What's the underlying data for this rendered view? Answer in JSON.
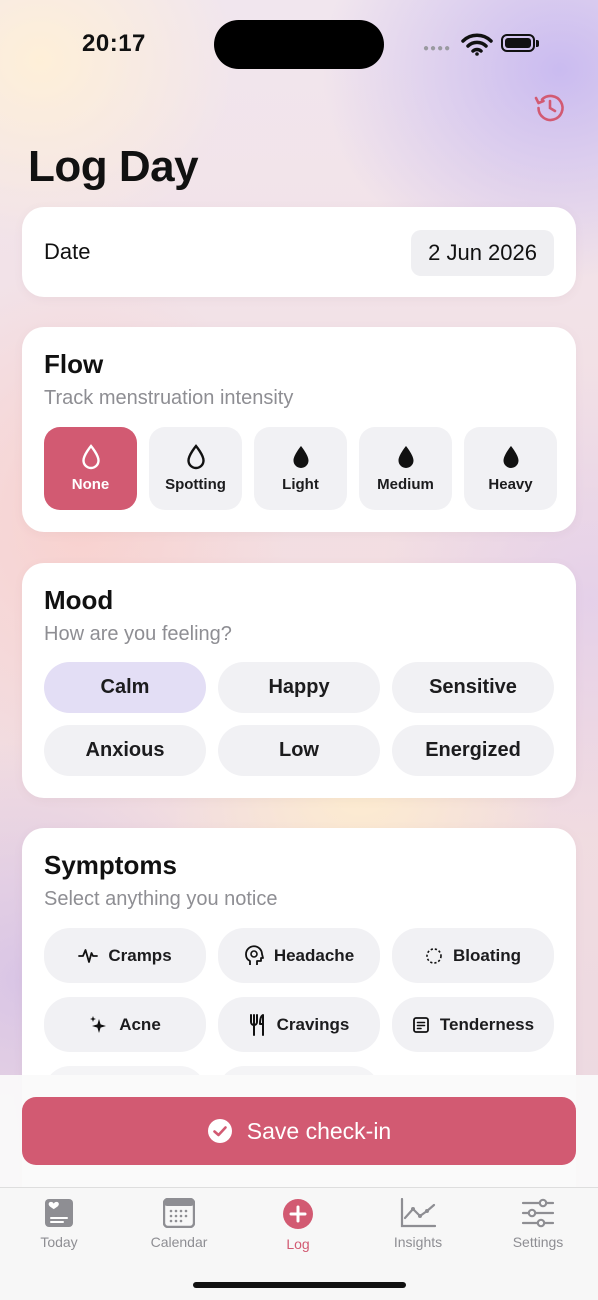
{
  "status_bar": {
    "time": "20:17"
  },
  "header": {
    "title": "Log Day"
  },
  "date_card": {
    "label": "Date",
    "value": "2 Jun 2026"
  },
  "flow": {
    "title": "Flow",
    "subtitle": "Track menstruation intensity",
    "options": [
      {
        "label": "None",
        "icon": "drop-outline-icon"
      },
      {
        "label": "Spotting",
        "icon": "drop-outline-icon"
      },
      {
        "label": "Light",
        "icon": "drop-filled-icon"
      },
      {
        "label": "Medium",
        "icon": "drop-filled-icon"
      },
      {
        "label": "Heavy",
        "icon": "drop-filled-icon"
      }
    ],
    "selected": "None"
  },
  "mood": {
    "title": "Mood",
    "subtitle": "How are you feeling?",
    "options": [
      "Calm",
      "Happy",
      "Sensitive",
      "Anxious",
      "Low",
      "Energized"
    ],
    "selected": "Calm"
  },
  "symptoms": {
    "title": "Symptoms",
    "subtitle": "Select anything you notice",
    "options": [
      {
        "label": "Cramps",
        "icon": "waveform-icon"
      },
      {
        "label": "Headache",
        "icon": "head-icon"
      },
      {
        "label": "Bloating",
        "icon": "dashed-circle-icon"
      },
      {
        "label": "Acne",
        "icon": "sparkles-icon"
      },
      {
        "label": "Cravings",
        "icon": "fork-knife-icon"
      },
      {
        "label": "Tenderness",
        "icon": "list-box-icon"
      }
    ]
  },
  "actions": {
    "save_label": "Save check-in"
  },
  "tabs": [
    {
      "label": "Today",
      "icon": "heart-doc-icon"
    },
    {
      "label": "Calendar",
      "icon": "calendar-icon"
    },
    {
      "label": "Log",
      "icon": "plus-circle-icon"
    },
    {
      "label": "Insights",
      "icon": "chart-line-icon"
    },
    {
      "label": "Settings",
      "icon": "sliders-icon"
    }
  ],
  "active_tab": "Log",
  "colors": {
    "accent": "#d25a72",
    "mood_selected": "#e3def5",
    "chip_bg": "#f1f1f4",
    "tab_inactive": "#8e8e93"
  }
}
